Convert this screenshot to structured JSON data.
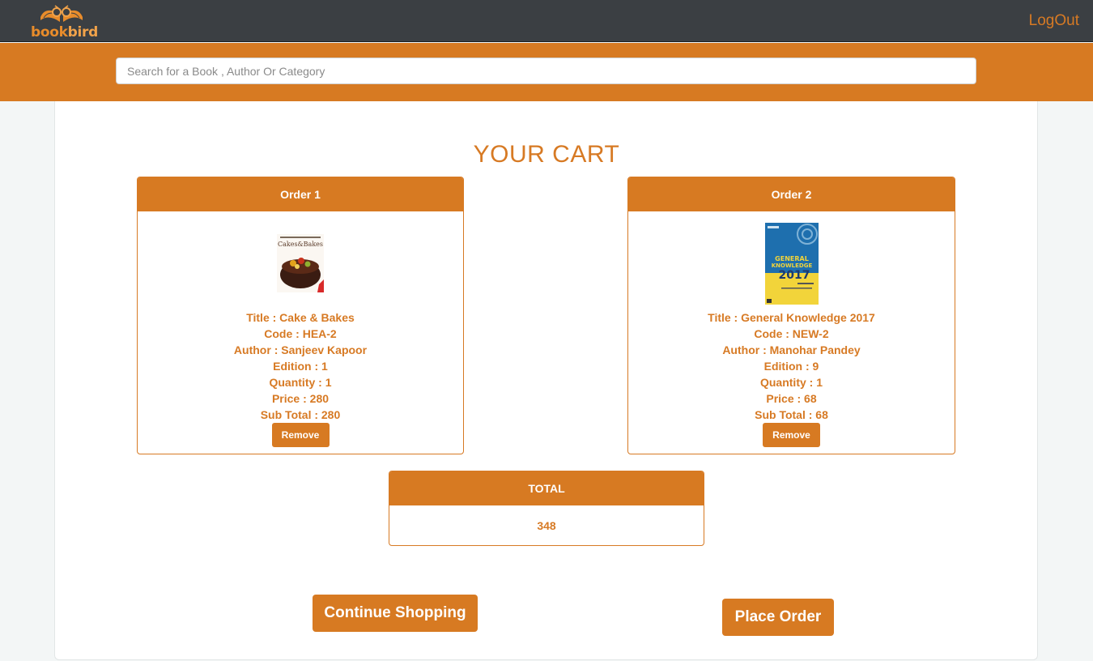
{
  "header": {
    "logo": {
      "text_book": "book",
      "text_bird": "bird"
    },
    "logout_label": "LogOut"
  },
  "search": {
    "placeholder": "Search for a Book , Author Or Category",
    "value": ""
  },
  "cart_title": "YOUR CART",
  "orders": [
    {
      "heading": "Order 1",
      "cover_text": "Cakes&Bakes",
      "title": "Title : Cake & Bakes",
      "code": "Code : HEA-2",
      "author": "Author : Sanjeev Kapoor",
      "edition": "Edition : 1",
      "quantity": "Quantity : 1",
      "price": "Price : 280",
      "subtotal": "Sub Total : 280",
      "remove_label": "Remove"
    },
    {
      "heading": "Order 2",
      "cover_text": "GENERAL KNOWLEDGE 2017",
      "title": "Title : General Knowledge 2017",
      "code": "Code : NEW-2",
      "author": "Author : Manohar Pandey",
      "edition": "Edition : 9",
      "quantity": "Quantity : 1",
      "price": "Price : 68",
      "subtotal": "Sub Total : 68",
      "remove_label": "Remove"
    }
  ],
  "total": {
    "heading": "TOTAL",
    "value": "348"
  },
  "actions": {
    "continue_label": "Continue Shopping",
    "place_order_label": "Place Order"
  },
  "colors": {
    "accent": "#d77a22",
    "topbar": "#3b3f43",
    "background": "#f3f6f6"
  }
}
